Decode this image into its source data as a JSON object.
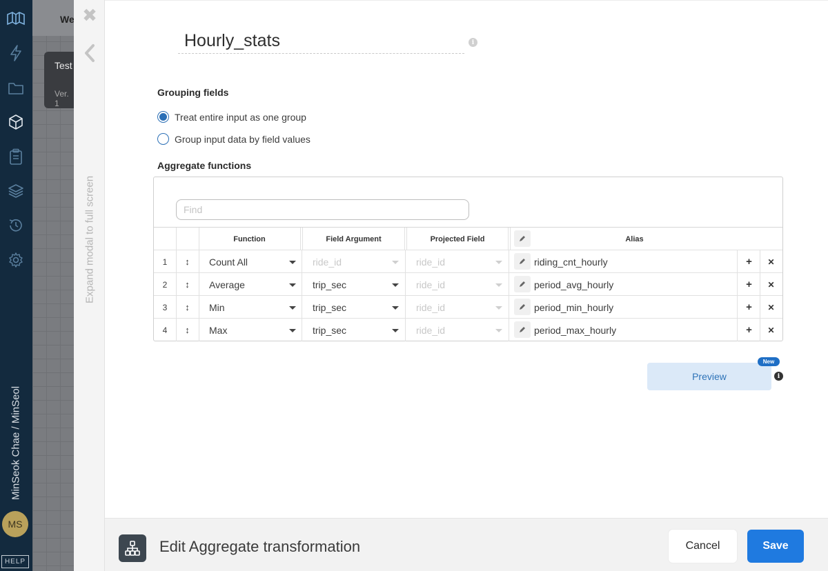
{
  "sidebar": {
    "user_name": "MinSeok Chae / MinSeol",
    "avatar_initials": "MS",
    "help_label": "HELP",
    "icons": [
      "logo-icon",
      "lightning-icon",
      "folder-icon",
      "cube-icon",
      "clipboard-icon",
      "layers-icon",
      "history-icon",
      "gear-icon"
    ]
  },
  "background_app": {
    "tab_label": "We",
    "card_title": "Test",
    "card_version": "Ver. 1"
  },
  "rail": {
    "expand_label": "Expand modal to full screen"
  },
  "modal": {
    "title": "Hourly_stats",
    "grouping_label": "Grouping fields",
    "grouping_options": [
      {
        "label": "Treat entire input as one group",
        "checked": true
      },
      {
        "label": "Group input data by field values",
        "checked": false
      }
    ],
    "aggregate_label": "Aggregate functions",
    "find_placeholder": "Find",
    "columns": {
      "function": "Function",
      "field_argument": "Field Argument",
      "projected_field": "Projected Field",
      "alias": "Alias"
    },
    "rows": [
      {
        "index": "1",
        "function": "Count All",
        "field_argument": "ride_id",
        "field_argument_disabled": true,
        "projected_field": "ride_id",
        "alias": "riding_cnt_hourly"
      },
      {
        "index": "2",
        "function": "Average",
        "field_argument": "trip_sec",
        "field_argument_disabled": false,
        "projected_field": "ride_id",
        "alias": "period_avg_hourly"
      },
      {
        "index": "3",
        "function": "Min",
        "field_argument": "trip_sec",
        "field_argument_disabled": false,
        "projected_field": "ride_id",
        "alias": "period_min_hourly"
      },
      {
        "index": "4",
        "function": "Max",
        "field_argument": "trip_sec",
        "field_argument_disabled": false,
        "projected_field": "ride_id",
        "alias": "period_max_hourly"
      }
    ],
    "preview_label": "Preview",
    "new_badge": "New"
  },
  "footer": {
    "title": "Edit Aggregate transformation",
    "cancel_label": "Cancel",
    "save_label": "Save"
  },
  "colors": {
    "sidebar_bg": "#132a3e",
    "accent": "#1f7ae0",
    "radio": "#2b6fb6",
    "preview_bg": "#dbe9f8"
  }
}
